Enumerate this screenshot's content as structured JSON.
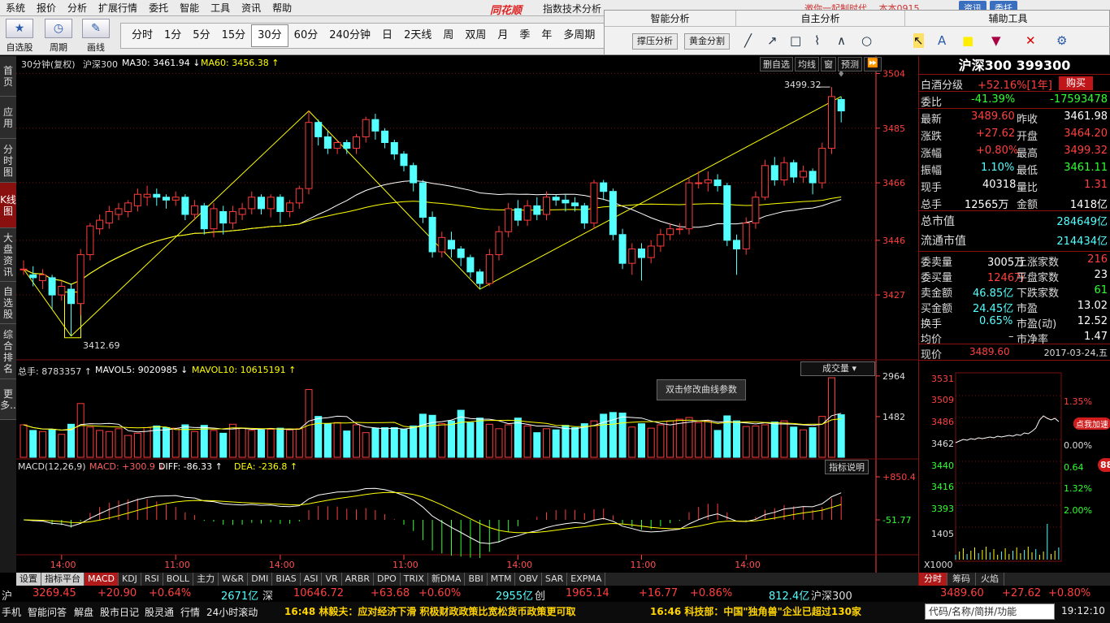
{
  "menu": [
    "系统",
    "报价",
    "分析",
    "扩展行情",
    "委托",
    "智能",
    "工具",
    "资讯",
    "帮助"
  ],
  "window": {
    "brand": "同花顺",
    "title": "指数技术分析",
    "right_text": "邀你一起制时代…  本本0915",
    "btn_trade": "资讯",
    "btn_entrust": "委托"
  },
  "toolbar": {
    "groups": [
      {
        "label": "自选股",
        "icon": "★"
      },
      {
        "label": "周期",
        "icon": "◷"
      },
      {
        "label": "画线",
        "icon": "✎"
      }
    ],
    "periods": [
      "分时",
      "1分",
      "5分",
      "15分",
      "30分",
      "60分",
      "240分钟",
      "日",
      "2天线",
      "周",
      "双周",
      "月",
      "季",
      "年",
      "多周期"
    ],
    "active_period": "30分"
  },
  "analysis": {
    "smart_title": "智能分析",
    "self_title": "自主分析",
    "aux_title": "辅助工具",
    "btn_pressure": "撑压分析",
    "btn_golden": "黄金分割",
    "draw_icons": [
      "╱",
      "↗",
      "□",
      "⌇",
      "∧",
      "○"
    ],
    "aux_icons": [
      "↖",
      "A",
      "■",
      "▼",
      "✕",
      "⚙"
    ]
  },
  "left_tabs": [
    "首页",
    "应用",
    "分时图",
    "K线图",
    "大盘资讯",
    "自选股",
    "综合排名",
    "更多.."
  ],
  "chart_header": {
    "period": "30分钟(复权)",
    "name": "沪深300",
    "ma30": "MA30: 3461.94 ↓",
    "ma60": "MA60: 3456.38 ↑",
    "buttons": [
      "删自选",
      "均线",
      "窗",
      "预测",
      "⏩"
    ],
    "high_label": "3499.32",
    "low_label": "3412.69"
  },
  "volume_header": {
    "total": "总手: 8783357 ↑",
    "mavol5": "MAVOL5: 9020985 ↓",
    "mavol10": "MAVOL10: 10615191 ↑",
    "button": "成交量 ▾",
    "tooltip": "双击修改曲线参数"
  },
  "macd_header": {
    "title": "MACD(12,26,9)",
    "macd": "MACD: +300.9 ↓",
    "diff": "DIFF: -86.33 ↑",
    "dea": "DEA: -236.8 ↑",
    "button": "指标说明"
  },
  "time_labels": [
    "14:00",
    "11:00",
    "14:00",
    "11:00",
    "14:00",
    "11:00",
    "14:00"
  ],
  "indicator_tabs": [
    "设置",
    "指标平台",
    "MACD",
    "KDJ",
    "RSI",
    "BOLL",
    "主力",
    "W&R",
    "DMI",
    "BIAS",
    "ASI",
    "VR",
    "ARBR",
    "DPO",
    "TRIX",
    "新DMA",
    "BBI",
    "MTM",
    "OBV",
    "SAR",
    "EXPMA"
  ],
  "colors": {
    "up": "#ff3c3c",
    "down": "#54ffff",
    "ma30": "#ffffff",
    "ma60": "#ffff00",
    "grid": "#7a1010",
    "axis": "#ff4040",
    "highlight": "#ffff00"
  },
  "chart_data": {
    "type": "candlestick",
    "candles": [
      [
        3436,
        3436,
        3434,
        3439
      ],
      [
        3434,
        3433,
        3430,
        3437
      ],
      [
        3432,
        3434,
        3429,
        3436
      ],
      [
        3433,
        3427,
        3422,
        3434
      ],
      [
        3427,
        3430,
        3425,
        3432
      ],
      [
        3429,
        3424,
        3412.69,
        3431
      ],
      [
        3424,
        3441,
        3420,
        3443
      ],
      [
        3441,
        3451,
        3439,
        3452
      ],
      [
        3450,
        3453,
        3448,
        3455
      ],
      [
        3452,
        3456,
        3450,
        3458
      ],
      [
        3455,
        3457,
        3453,
        3459
      ],
      [
        3456,
        3459,
        3454,
        3460
      ],
      [
        3458,
        3462,
        3456,
        3464
      ],
      [
        3461,
        3462,
        3458,
        3465
      ],
      [
        3462,
        3461,
        3458,
        3464
      ],
      [
        3461,
        3460,
        3457,
        3462
      ],
      [
        3460,
        3461,
        3458,
        3463
      ],
      [
        3461,
        3455,
        3453,
        3462
      ],
      [
        3455,
        3458,
        3453,
        3460
      ],
      [
        3458,
        3450,
        3448,
        3459
      ],
      [
        3450,
        3457,
        3447,
        3459
      ],
      [
        3456,
        3452,
        3448,
        3458
      ],
      [
        3452,
        3456,
        3450,
        3458
      ],
      [
        3455,
        3457,
        3453,
        3459
      ],
      [
        3457,
        3461,
        3455,
        3463
      ],
      [
        3461,
        3457,
        3455,
        3462
      ],
      [
        3457,
        3461,
        3454,
        3462
      ],
      [
        3461,
        3456,
        3452,
        3462
      ],
      [
        3456,
        3459,
        3454,
        3460
      ],
      [
        3459,
        3464,
        3457,
        3465
      ],
      [
        3464,
        3487,
        3462,
        3491
      ],
      [
        3487,
        3482,
        3479,
        3488
      ],
      [
        3482,
        3478,
        3476,
        3484
      ],
      [
        3478,
        3480,
        3476,
        3481
      ],
      [
        3480,
        3478,
        3476,
        3481
      ],
      [
        3478,
        3482,
        3476,
        3483
      ],
      [
        3482,
        3488,
        3480,
        3489
      ],
      [
        3488,
        3484,
        3481,
        3490
      ],
      [
        3484,
        3480,
        3478,
        3485
      ],
      [
        3480,
        3476,
        3474,
        3481
      ],
      [
        3476,
        3472,
        3470,
        3477
      ],
      [
        3472,
        3466,
        3463,
        3473
      ],
      [
        3466,
        3454,
        3452,
        3467
      ],
      [
        3454,
        3442,
        3440,
        3456
      ],
      [
        3442,
        3447,
        3440,
        3449
      ],
      [
        3446,
        3443,
        3440,
        3449
      ],
      [
        3443,
        3440,
        3437,
        3444
      ],
      [
        3440,
        3435,
        3433,
        3441
      ],
      [
        3435,
        3431,
        3429,
        3436
      ],
      [
        3431,
        3441,
        3430,
        3443
      ],
      [
        3441,
        3449,
        3439,
        3451
      ],
      [
        3449,
        3457,
        3447,
        3459
      ],
      [
        3457,
        3453,
        3451,
        3460
      ],
      [
        3453,
        3458,
        3451,
        3460
      ],
      [
        3458,
        3455,
        3453,
        3461
      ],
      [
        3455,
        3461,
        3453,
        3463
      ],
      [
        3461,
        3460,
        3458,
        3462
      ],
      [
        3460,
        3459,
        3456,
        3462
      ],
      [
        3459,
        3458,
        3456,
        3461
      ],
      [
        3458,
        3452,
        3450,
        3459
      ],
      [
        3452,
        3466,
        3450,
        3467
      ],
      [
        3466,
        3463,
        3460,
        3467
      ],
      [
        3463,
        3448,
        3446,
        3464
      ],
      [
        3448,
        3438,
        3436,
        3450
      ],
      [
        3438,
        3443,
        3434,
        3445
      ],
      [
        3443,
        3440,
        3432,
        3445
      ],
      [
        3440,
        3444,
        3438,
        3446
      ],
      [
        3444,
        3448,
        3442,
        3450
      ],
      [
        3448,
        3450,
        3446,
        3452
      ],
      [
        3450,
        3450,
        3448,
        3452
      ],
      [
        3450,
        3466,
        3448,
        3468
      ],
      [
        3466,
        3466,
        3464,
        3470
      ],
      [
        3466,
        3467,
        3463,
        3470
      ],
      [
        3467,
        3465,
        3463,
        3469
      ],
      [
        3465,
        3446,
        3444,
        3466
      ],
      [
        3446,
        3443,
        3434,
        3448
      ],
      [
        3443,
        3452,
        3441,
        3454
      ],
      [
        3452,
        3461,
        3450,
        3463
      ],
      [
        3461,
        3472,
        3460,
        3474
      ],
      [
        3472,
        3467,
        3465,
        3475
      ],
      [
        3467,
        3473,
        3465,
        3475
      ],
      [
        3473,
        3468,
        3466,
        3474
      ],
      [
        3468,
        3470,
        3466,
        3472
      ],
      [
        3470,
        3466,
        3462,
        3471
      ],
      [
        3466,
        3478,
        3464,
        3480
      ],
      [
        3478,
        3496,
        3476,
        3499.32
      ],
      [
        3495,
        3491,
        3487,
        3496
      ]
    ],
    "volume": [
      5.8,
      4.8,
      4.6,
      5.0,
      4.1,
      5.9,
      9.6,
      5.4,
      4.8,
      4.6,
      5.1,
      3.9,
      4.3,
      5.3,
      5.6,
      5.3,
      5.2,
      5.8,
      4.6,
      5.7,
      4.8,
      4.3,
      5.9,
      5.2,
      4.8,
      4.9,
      5.0,
      5.2,
      4.9,
      5.1,
      12.1,
      7.3,
      6.0,
      6.2,
      4.7,
      5.8,
      4.4,
      5.2,
      5.3,
      5.3,
      5.0,
      5.6,
      7.7,
      7.5,
      6.0,
      6.5,
      8.4,
      6.2,
      7.0,
      5.9,
      5.1,
      5.8,
      7.0,
      5.6,
      4.4,
      5.1,
      4.9,
      5.7,
      5.3,
      6.0,
      6.5,
      7.7,
      8.0,
      7.9,
      5.4,
      6.0,
      5.2,
      5.8,
      6.5,
      6.8,
      7.1,
      6.2,
      6.5,
      4.8,
      7.4,
      6.5,
      5.5,
      5.6,
      5.8,
      6.3,
      6.5,
      5.4,
      4.9,
      5.3,
      7.3,
      14.2,
      7.6
    ],
    "price_axis": [
      3504,
      3485,
      3466,
      3446,
      3427
    ],
    "volume_axis": [
      2964,
      1482
    ],
    "macd_axis": [
      "+850.4",
      "-51.77"
    ],
    "price_range": [
      3405,
      3505
    ]
  },
  "quote": {
    "title": "沪深300 399300",
    "rows": [
      {
        "l": "白酒分级",
        "v": "+52.16%[1年]",
        "b": "购买"
      },
      {
        "l": "委比",
        "v": "-41.39%",
        "v2": "-17593478"
      },
      {
        "l": "最新",
        "v": "3489.60",
        "l2": "昨收",
        "v2": "3461.98"
      },
      {
        "l": "涨跌",
        "v": "+27.62",
        "l2": "开盘",
        "v2": "3464.20"
      },
      {
        "l": "涨幅",
        "v": "+0.80%",
        "l2": "最高",
        "v2": "3499.32"
      },
      {
        "l": "振幅",
        "v": "1.10%",
        "l2": "最低",
        "v2": "3461.11"
      },
      {
        "l": "现手",
        "v": "40318",
        "l2": "量比",
        "v2": "1.31"
      },
      {
        "l": "总手",
        "v": "12565万",
        "l2": "金额",
        "v2": "1418亿"
      }
    ],
    "mv": {
      "l1": "总市值",
      "v1": "284649亿",
      "l2": "流通市值",
      "v2": "214434亿"
    },
    "breadth": [
      {
        "l": "委卖量",
        "v": "3005万",
        "l2": "上涨家数",
        "v2": "216"
      },
      {
        "l": "委买量",
        "v": "1246万",
        "l2": "平盘家数",
        "v2": "23"
      },
      {
        "l": "卖金额",
        "v": "46.85亿",
        "l2": "下跌家数",
        "v2": "61"
      },
      {
        "l": "买金额",
        "v": "24.45亿",
        "l2": "市盈",
        "v2": "13.02"
      },
      {
        "l": "换手",
        "v": "0.65%",
        "l2": "市盈(动)",
        "v2": "12.52"
      },
      {
        "l": "均价",
        "v": "–",
        "l2": "市净率",
        "v2": "1.47"
      }
    ],
    "now": {
      "l": "现价",
      "v": "3489.60",
      "date": "2017-03-24,五"
    },
    "mini_axis_left": [
      "3531",
      "3509",
      "3486",
      "3462",
      "3440",
      "3416",
      "3393",
      "1405",
      "X1000"
    ],
    "mini_axis_right": [
      "1.35%",
      "0.00%",
      "0.64",
      "1.32%",
      "2.00%"
    ],
    "promo": "点我加速",
    "promo_num": "88",
    "tabs": [
      "分时",
      "筹码",
      "火焰"
    ]
  },
  "status": {
    "idx1_name": "沪",
    "idx1_val": "3269.45",
    "idx1_chg": "+20.90",
    "idx1_pct": "+0.64%",
    "idx1_amt": "2671亿",
    "idx2_name": "深",
    "idx2_val": "10646.72",
    "idx2_chg": "+63.68",
    "idx2_pct": "+0.60%",
    "idx2_amt": "2955亿",
    "idx3_name": "创",
    "idx3_val": "1965.14",
    "idx3_chg": "+16.77",
    "idx3_pct": "+0.86%",
    "idx3_amt": "812.4亿",
    "idx4_name": "沪深300",
    "idx4_val": "3489.60",
    "idx4_chg": "+27.62",
    "idx4_pct": "+0.80%"
  },
  "footer": {
    "items": [
      "手机",
      "智能问答",
      "解盘",
      "股市日记",
      "股灵通",
      "行情",
      "24小时滚动"
    ],
    "news1": "16:48 林毅夫：应对经济下滑 积极财政政策比宽松货币政策更可取",
    "news2": "16:46 科技部：中国\"独角兽\"企业已超过130家",
    "search": "代码/名称/简拼/功能",
    "clock": "19:12:10"
  }
}
